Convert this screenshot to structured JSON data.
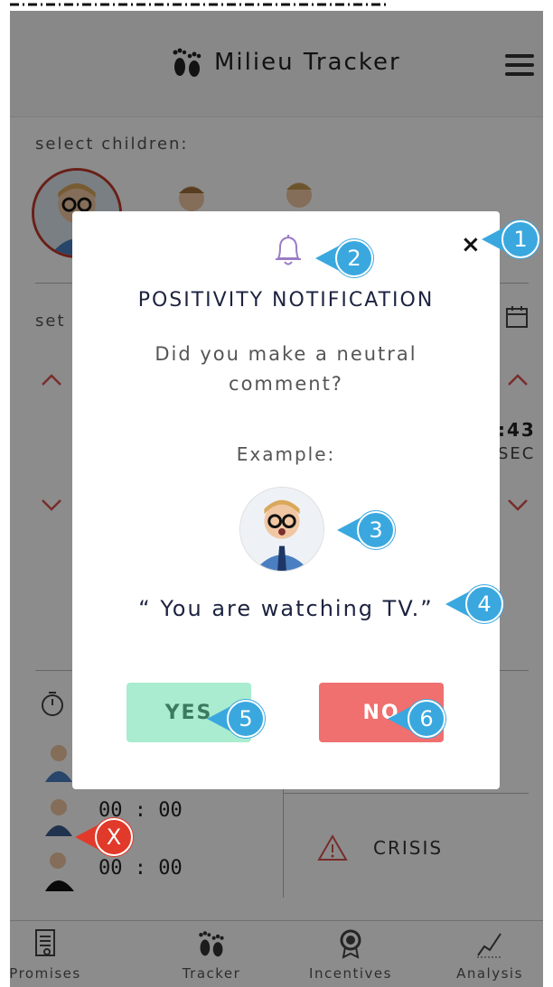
{
  "app": {
    "title": "Milieu Tracker"
  },
  "select_children": {
    "label": "select children:"
  },
  "set_section": {
    "label": "set",
    "time_value": ":43",
    "time_unit": "SEC"
  },
  "timers": [
    {
      "time": "00 : 00"
    },
    {
      "time": "00 : 00"
    }
  ],
  "crisis": {
    "label": "CRISIS"
  },
  "nav": {
    "items": [
      {
        "label": "Promises",
        "icon": "document-icon"
      },
      {
        "label": "Tracker",
        "icon": "feet-icon"
      },
      {
        "label": "Incentives",
        "icon": "award-icon"
      },
      {
        "label": "Analysis",
        "icon": "chart-icon"
      }
    ]
  },
  "modal": {
    "close": "×",
    "title": "POSITIVITY NOTIFICATION",
    "question": "Did you make a neutral comment?",
    "example_label": "Example:",
    "quote": "“ You are watching TV.”",
    "yes_label": "YES",
    "no_label": "NO"
  },
  "callouts": [
    "1",
    "2",
    "3",
    "4",
    "5",
    "6",
    "X"
  ],
  "colors": {
    "accent_blue": "#3aa8df",
    "callout_red": "#e13a2a",
    "yes_bg": "#a9ecd0",
    "no_bg": "#f06f6f",
    "chevron_red": "#d9534f",
    "bell_purple": "#9a7cc6"
  }
}
